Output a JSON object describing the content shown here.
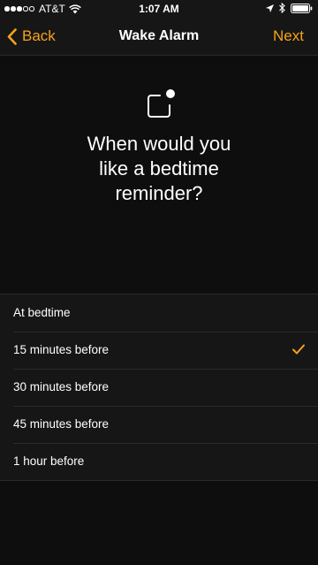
{
  "status_bar": {
    "carrier": "AT&T",
    "time": "1:07 AM",
    "signal_bars_filled": 3,
    "signal_bars_total": 5
  },
  "nav": {
    "back_label": "Back",
    "title": "Wake Alarm",
    "next_label": "Next"
  },
  "main": {
    "icon": "reminder-icon",
    "headline": "When would you\nlike a bedtime\nreminder?"
  },
  "options": [
    {
      "label": "At bedtime",
      "selected": false
    },
    {
      "label": "15 minutes before",
      "selected": true
    },
    {
      "label": "30 minutes before",
      "selected": false
    },
    {
      "label": "45 minutes before",
      "selected": false
    },
    {
      "label": "1 hour before",
      "selected": false
    }
  ],
  "colors": {
    "accent": "#f7a21a",
    "background": "#0e0e0e",
    "bar": "#161616"
  }
}
